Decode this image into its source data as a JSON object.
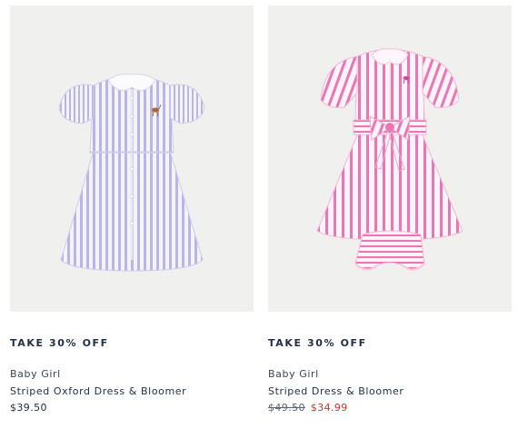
{
  "products": [
    {
      "promo": "TAKE 30% OFF",
      "category": "Baby Girl",
      "name": "Striped Oxford Dress & Bloomer",
      "price": "$39.50",
      "image_alt": "lavender-striped-oxford-dress"
    },
    {
      "promo": "TAKE 30% OFF",
      "category": "Baby Girl",
      "name": "Striped Dress & Bloomer",
      "price_original": "$49.50",
      "price_sale": "$34.99",
      "image_alt": "pink-striped-dress-with-bloomer"
    }
  ],
  "colors": {
    "image_background": "#f0f0ef",
    "lavender_stripe": "#b9b6e6",
    "pink_stripe": "#ec76b2",
    "sale_price": "#c0392b",
    "text": "#22304a"
  }
}
